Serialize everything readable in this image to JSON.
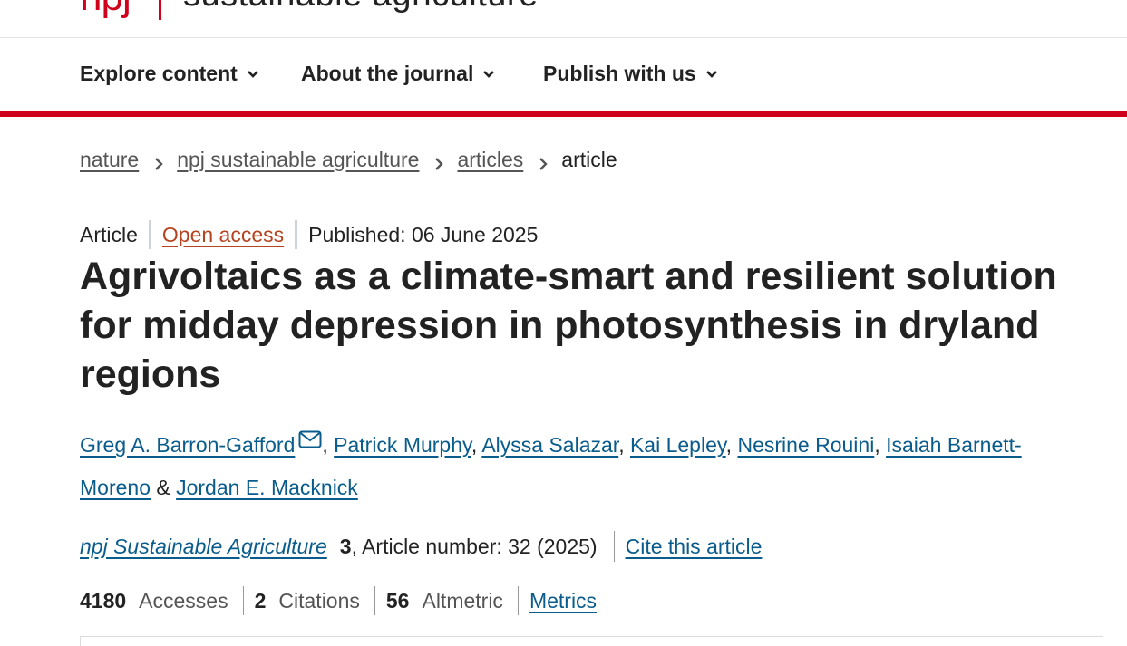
{
  "brand": {
    "logo_text": "npj",
    "journal_name": "sustainable agriculture",
    "accent_color": "#d0021b"
  },
  "nav": {
    "items": [
      {
        "label": "Explore content",
        "icon": "chevron-down-icon"
      },
      {
        "label": "About the journal",
        "icon": "chevron-down-icon"
      },
      {
        "label": "Publish with us",
        "icon": "chevron-down-icon"
      }
    ]
  },
  "breadcrumb": {
    "items": [
      "nature",
      "npj sustainable agriculture",
      "articles"
    ],
    "current": "article"
  },
  "meta": {
    "type": "Article",
    "access": "Open access",
    "published": "Published: 06 June 2025"
  },
  "title": "Agrivoltaics as a climate-smart and resilient solution for midday depression in photosynthesis in dryland regions",
  "authors": [
    "Greg A. Barron-Gafford",
    "Patrick Murphy",
    "Alyssa Salazar",
    "Kai Lepley",
    "Nesrine Rouini",
    "Isaiah Barnett-Moreno",
    "Jordan E. Macknick"
  ],
  "author_separators": {
    "comma": ", ",
    "and": " & "
  },
  "citation": {
    "journal": "npj Sustainable Agriculture",
    "volume": "3",
    "article_number": ", Article number: 32 (2025)",
    "cite_link": "Cite this article"
  },
  "metrics": {
    "accesses": {
      "value": "4180",
      "label": "Accesses"
    },
    "citations": {
      "value": "2",
      "label": "Citations"
    },
    "altmetric": {
      "value": "56",
      "label": "Altmetric"
    },
    "link": "Metrics"
  },
  "colors": {
    "link": "#0a5c8c",
    "open_access": "#b5431f",
    "text": "#222222"
  }
}
